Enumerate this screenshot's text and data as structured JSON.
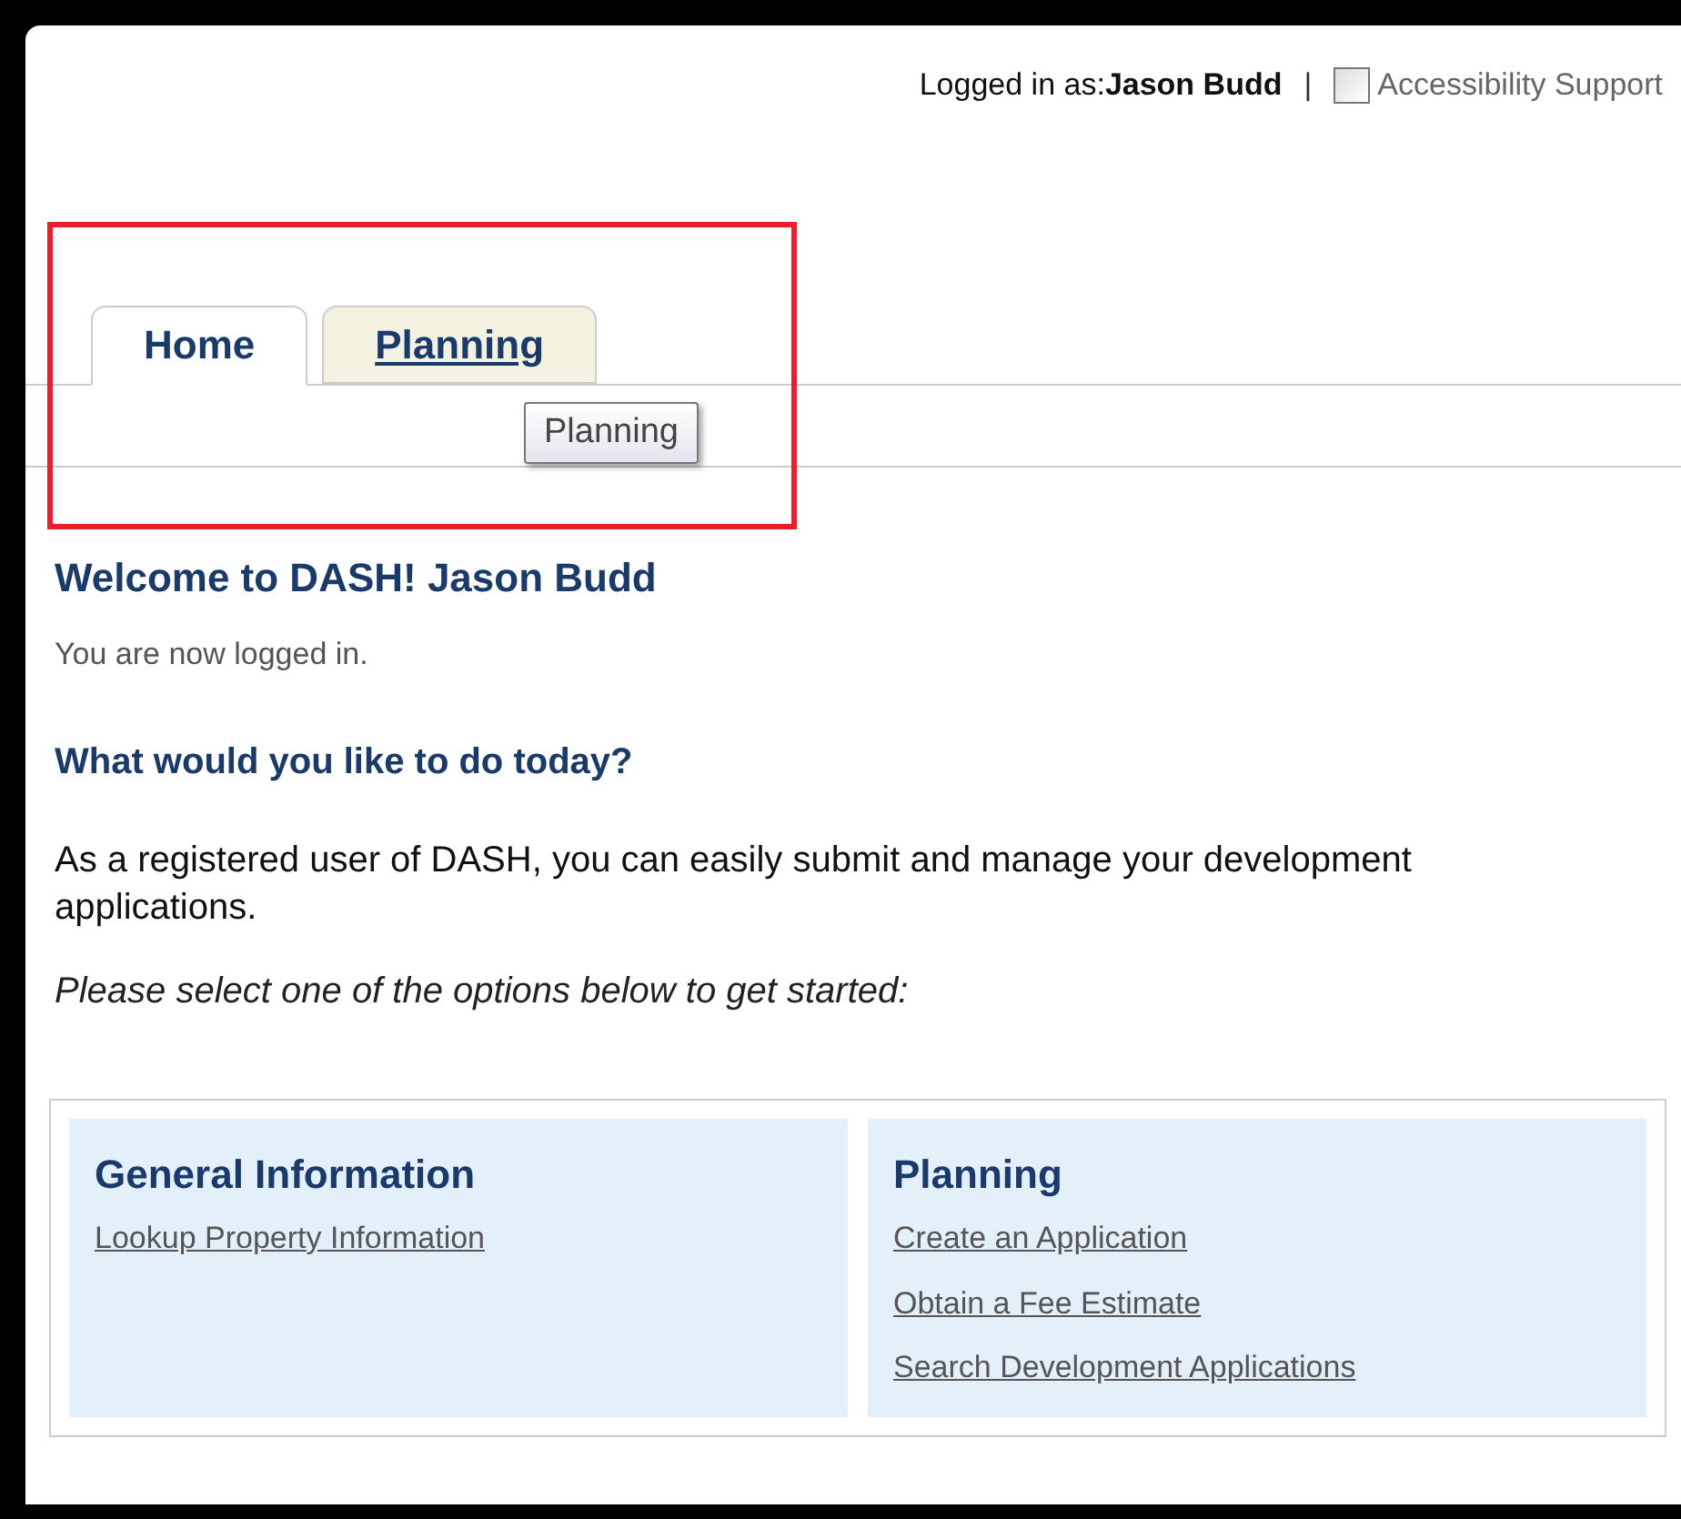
{
  "header": {
    "logged_in": "Logged in as:**Jason Budd**",
    "separator": "|",
    "accessibility": {
      "label": "Accessibility Support",
      "checked": false
    }
  },
  "tabs": [
    {
      "label": "Home",
      "selected": true
    },
    {
      "label": "Planning",
      "selected": false
    }
  ],
  "tooltip": "Planning",
  "welcome": {
    "title": "Welcome to DASH! Jason Budd",
    "subtitle": "You are now logged in."
  },
  "prompt": "What would you like to do today?",
  "intro": "As a registered user of DASH, you can easily submit and manage your development applications.",
  "instruction": "Please select one of the options below to get started:",
  "panels": [
    {
      "title": "General Information",
      "links": [
        "Lookup Property Information"
      ]
    },
    {
      "title": "Planning",
      "links": [
        "Create an Application",
        "Obtain a Fee Estimate",
        "Search Development Applications"
      ]
    }
  ]
}
